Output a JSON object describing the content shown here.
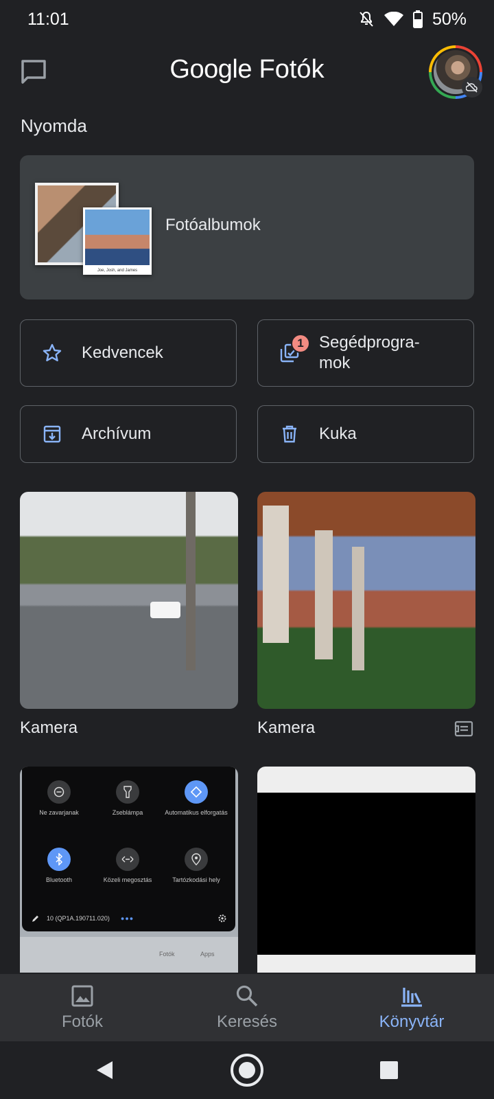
{
  "status_bar": {
    "time": "11:01",
    "battery": "50%"
  },
  "header": {
    "title_brand": "Google",
    "title_product": "Fotók"
  },
  "print_section": {
    "title": "Nyomda",
    "card_label": "Fotóalbumok",
    "thumb_caption": "Joe, Josh, and James"
  },
  "quick_buttons": {
    "favorites": "Kedvencek",
    "utilities": "Segédprogra-\nmok",
    "utilities_badge": "1",
    "archive": "Archívum",
    "trash": "Kuka"
  },
  "albums": [
    {
      "label": "Kamera"
    },
    {
      "label": "Kamera"
    }
  ],
  "quick_settings_preview": {
    "tiles": [
      "Ne zavarjanak",
      "Zseblámpa",
      "Automatikus elforgatás",
      "Bluetooth",
      "Közeli megosztás",
      "Tartózkodási hely"
    ],
    "build": "10 (QP1A.190711.020)",
    "home_labels": [
      "Fotók",
      "Apps"
    ]
  },
  "bottom_nav": {
    "photos": "Fotók",
    "search": "Keresés",
    "library": "Könyvtár"
  },
  "colors": {
    "accent": "#8ab4f8",
    "background": "#202124",
    "card": "#3c4043",
    "badge": "#f28b82"
  }
}
